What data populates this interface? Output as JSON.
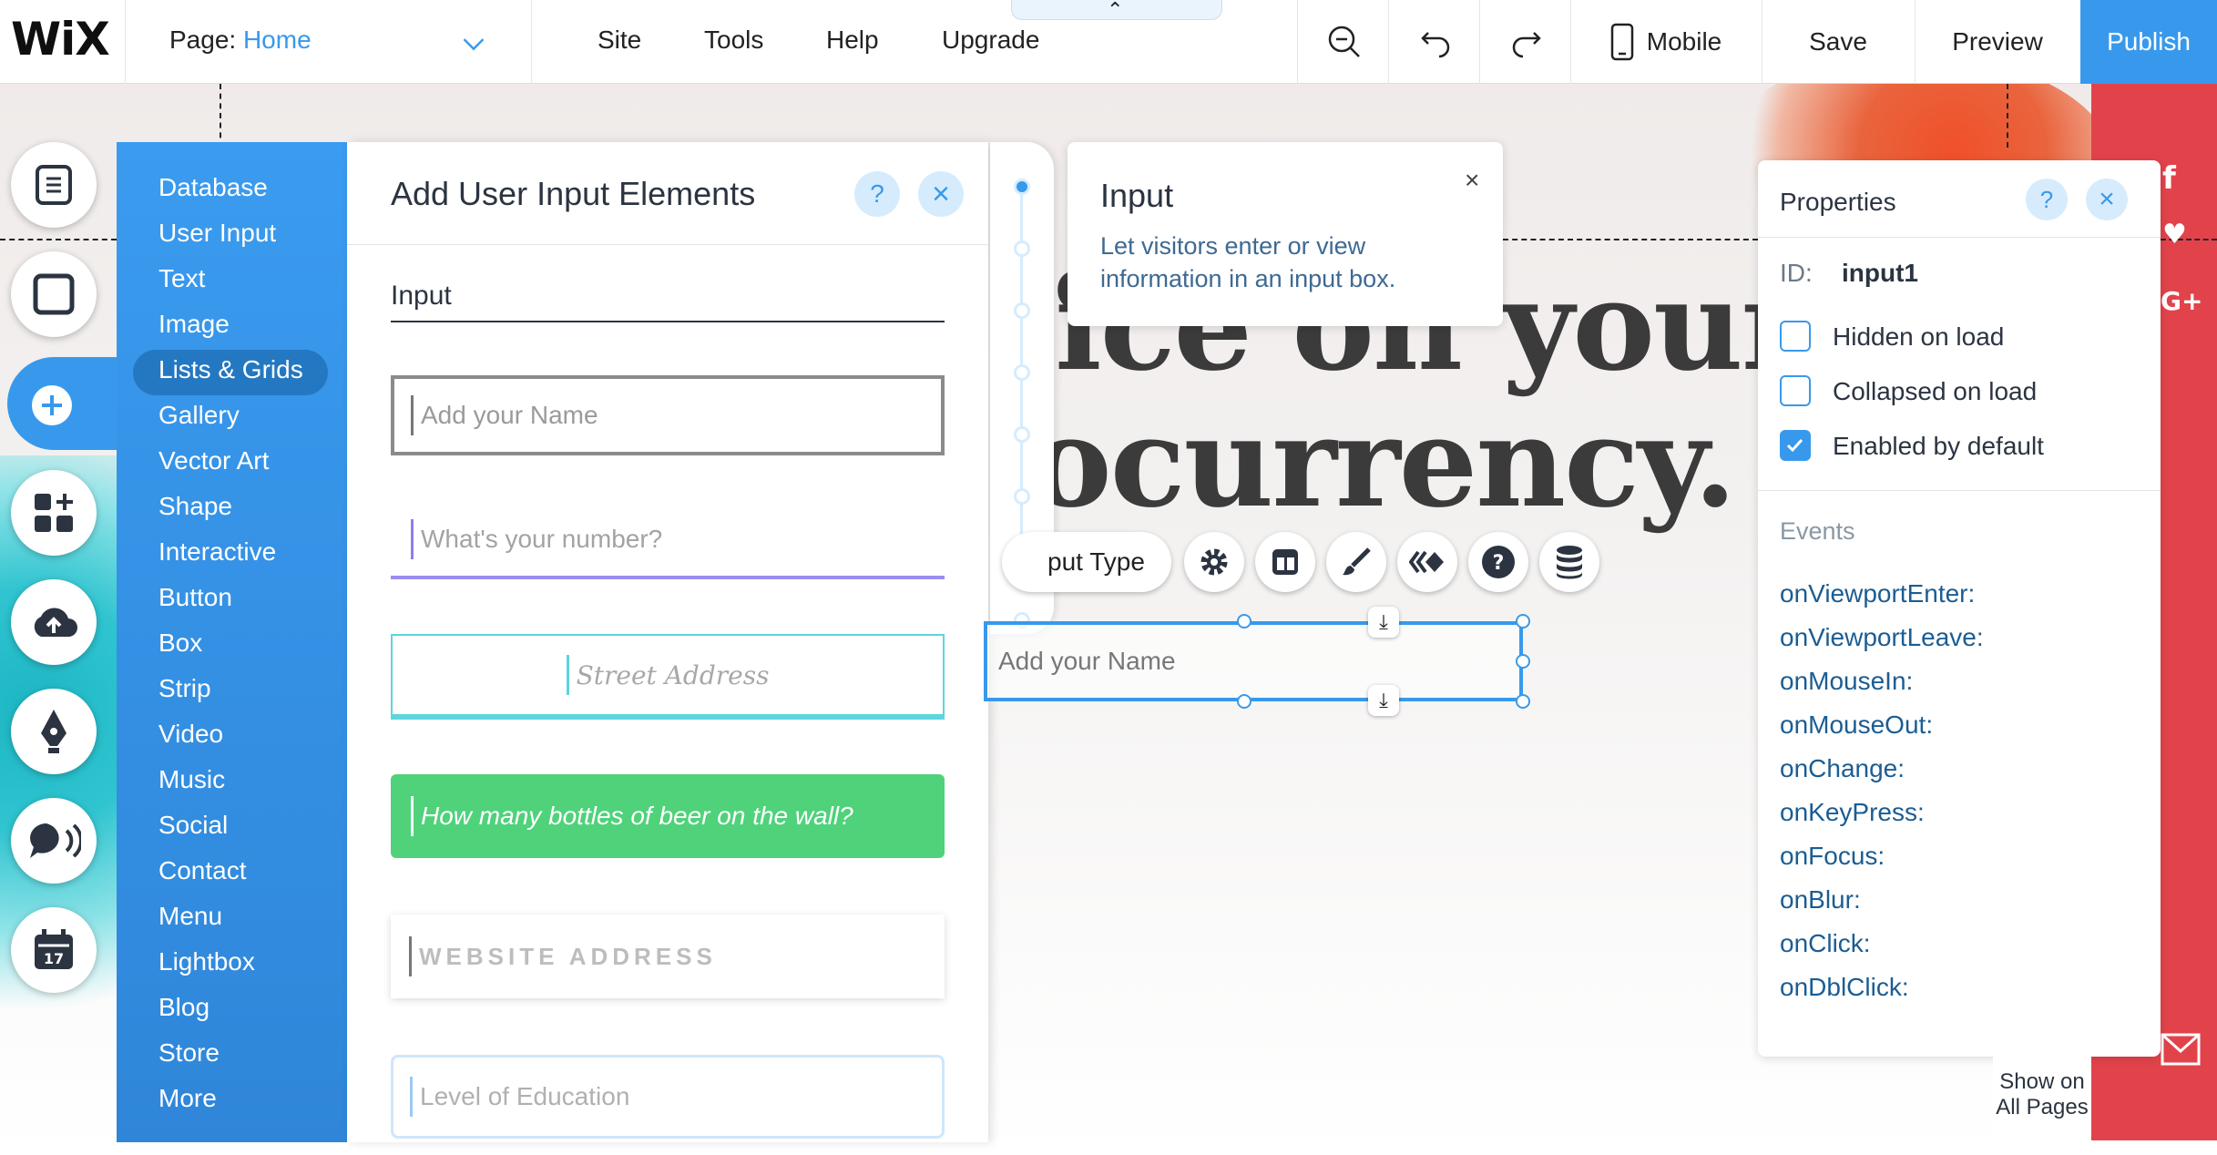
{
  "topbar": {
    "logo": "WiX",
    "page_label": "Page:",
    "page_value": "Home",
    "menu": {
      "site": "Site",
      "tools": "Tools",
      "help": "Help",
      "upgrade": "Upgrade"
    },
    "collapse_glyph": "⌃",
    "mobile": "Mobile",
    "save": "Save",
    "preview": "Preview",
    "publish": "Publish"
  },
  "categories": [
    "Database",
    "User Input",
    "Text",
    "Image",
    "Lists & Grids",
    "Gallery",
    "Vector Art",
    "Shape",
    "Interactive",
    "Button",
    "Box",
    "Strip",
    "Video",
    "Music",
    "Social",
    "Contact",
    "Menu",
    "Lightbox",
    "Blog",
    "Store",
    "More"
  ],
  "selected_category": "User Input",
  "add_panel": {
    "title": "Add User Input Elements",
    "help": "?",
    "close": "×",
    "section": "Input",
    "samples": {
      "name": "Add your Name",
      "number": "What's your number?",
      "street": "Street Address",
      "beer": "How many bottles of beer on the wall?",
      "website": "WEBSITE ADDRESS",
      "education": "Level of Education"
    }
  },
  "tooltip": {
    "title": "Input",
    "text": "Let visitors enter or view information in an input box.",
    "close": "×"
  },
  "canvas": {
    "hero_line1": "ice on your",
    "hero_line2": "ocurrency.",
    "hero_fragment": "o",
    "selected_input_text": "Add your Name",
    "input_type_button": "put Type"
  },
  "properties": {
    "title": "Properties",
    "help": "?",
    "close": "×",
    "id_label": "ID:",
    "id_value": "input1",
    "options": [
      {
        "label": "Hidden on load",
        "checked": false
      },
      {
        "label": "Collapsed on load",
        "checked": false
      },
      {
        "label": "Enabled by default",
        "checked": true
      }
    ],
    "events_label": "Events",
    "events": [
      "onViewportEnter:",
      "onViewportLeave:",
      "onMouseIn:",
      "onMouseOut:",
      "onChange:",
      "onKeyPress:",
      "onFocus:",
      "onBlur:",
      "onClick:",
      "onDblClick:"
    ]
  },
  "show_on_all_pages": "Show on All Pages",
  "colors": {
    "accent": "#3899ec",
    "panel_blue": "#3a9bef",
    "beer_green": "#4fd27a",
    "site_red": "#e2434b"
  }
}
